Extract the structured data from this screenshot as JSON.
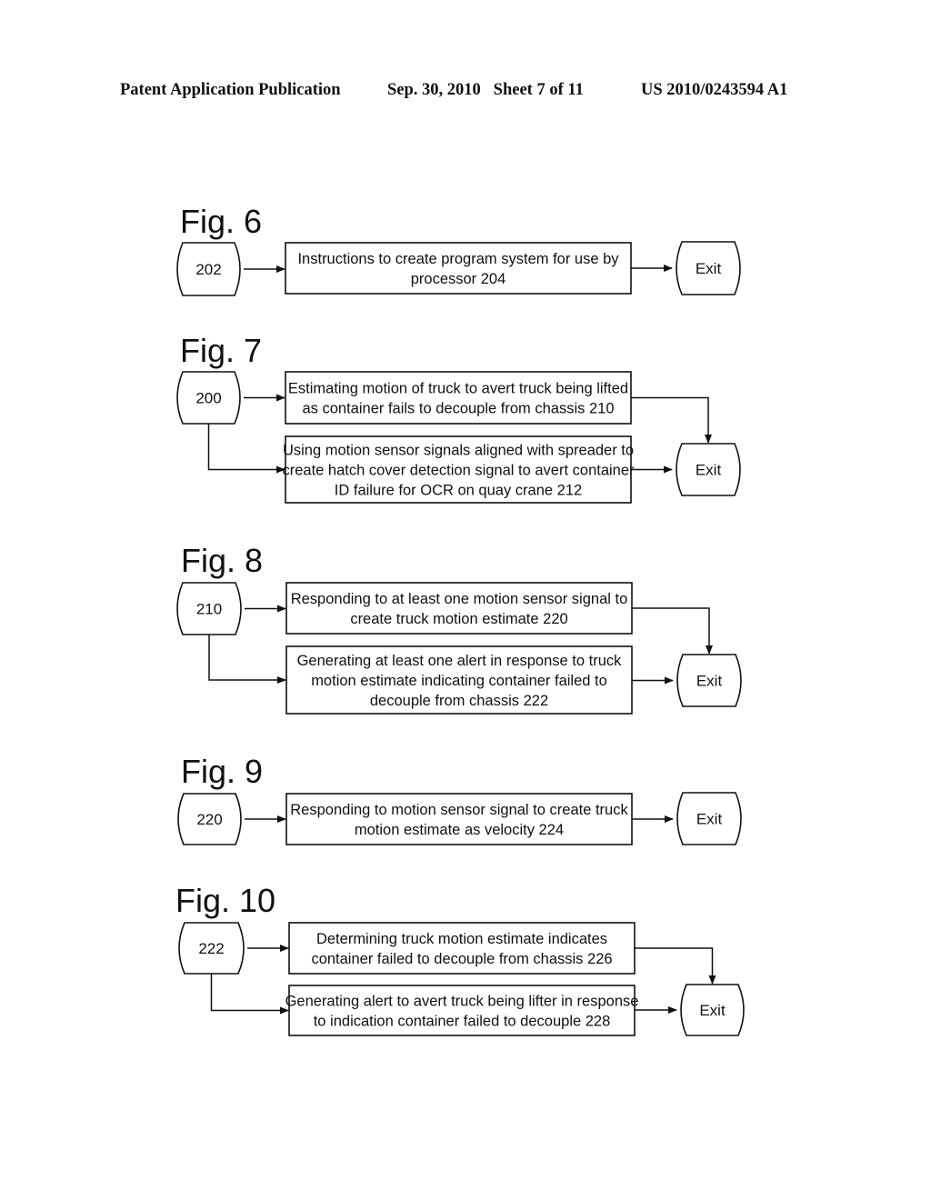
{
  "header": {
    "left": "Patent Application Publication",
    "middle": "Sep. 30, 2010   Sheet 7 of 11",
    "right": "US 2010/0243594 A1"
  },
  "figures": [
    {
      "id": "fig6",
      "label": "Fig. 6",
      "start": "202",
      "exit": "Exit",
      "steps": [
        {
          "lines": [
            "Instructions to create program system for use by",
            "processor 204"
          ]
        }
      ]
    },
    {
      "id": "fig7",
      "label": "Fig. 7",
      "start": "200",
      "exit": "Exit",
      "steps": [
        {
          "lines": [
            "Estimating motion of truck to avert truck being lifted",
            "as container fails to decouple from chassis 210"
          ]
        },
        {
          "lines": [
            "Using motion sensor signals aligned with spreader to",
            "create hatch cover detection signal to avert container",
            "ID failure for OCR on quay crane 212"
          ]
        }
      ]
    },
    {
      "id": "fig8",
      "label": "Fig. 8",
      "start": "210",
      "exit": "Exit",
      "steps": [
        {
          "lines": [
            "Responding to at least one motion sensor signal to",
            "create truck motion estimate 220"
          ]
        },
        {
          "lines": [
            "Generating at least one alert in response to truck",
            "motion estimate indicating container failed to",
            "decouple from chassis 222"
          ]
        }
      ]
    },
    {
      "id": "fig9",
      "label": "Fig. 9",
      "start": "220",
      "exit": "Exit",
      "steps": [
        {
          "lines": [
            "Responding to motion sensor signal to create truck",
            "motion estimate as velocity 224"
          ]
        }
      ]
    },
    {
      "id": "fig10",
      "label": "Fig. 10",
      "start": "222",
      "exit": "Exit",
      "steps": [
        {
          "lines": [
            "Determining truck motion estimate indicates",
            "container failed to decouple from chassis 226"
          ]
        },
        {
          "lines": [
            "Generating alert to avert truck being lifter in response",
            "to indication container failed to decouple 228"
          ]
        }
      ]
    }
  ]
}
